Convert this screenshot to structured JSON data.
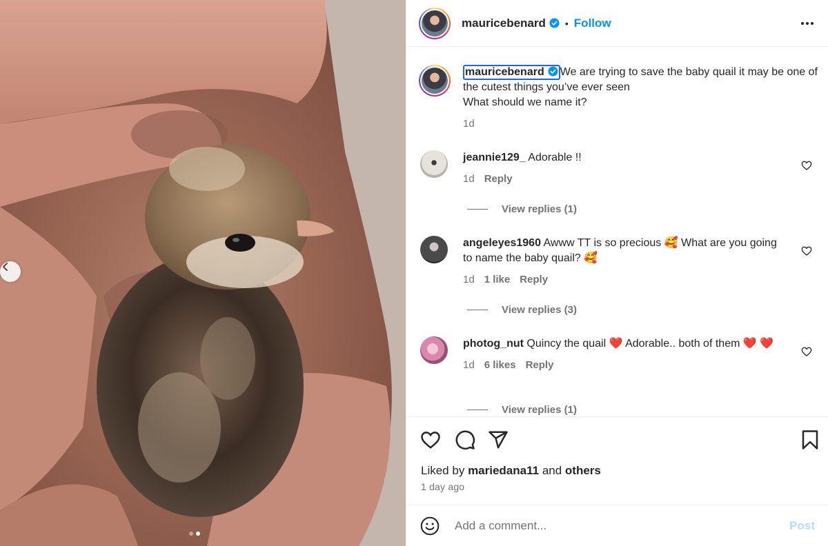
{
  "post": {
    "username": "mauricebenard",
    "separator": "•",
    "follow_label": "Follow",
    "caption_line1": "We are trying to save the baby quail it may be one of the cutest things you’ve ever seen",
    "caption_line2": "What should we name it?",
    "caption_time": "1d"
  },
  "comments": [
    {
      "user": "jeannie129_",
      "text": "Adorable !!",
      "time": "1d",
      "likes": "",
      "reply_label": "Reply",
      "view_replies": "View replies (1)"
    },
    {
      "user": "angeleyes1960",
      "text": "Awww TT is so precious 🥰 What are you going to name the baby quail? 🥰",
      "time": "1d",
      "likes": "1 like",
      "reply_label": "Reply",
      "view_replies": "View replies (3)"
    },
    {
      "user": "photog_nut",
      "text": "Quincy the quail ❤️ Adorable.. both of them ❤️ ❤️",
      "time": "1d",
      "likes": "6 likes",
      "reply_label": "Reply",
      "view_replies": "View replies (1)"
    }
  ],
  "likes": {
    "prefix": "Liked by",
    "user": "mariedana11",
    "and": "and",
    "others": "others"
  },
  "timestamp": "1 day ago",
  "composer": {
    "placeholder": "Add a comment...",
    "post_label": "Post"
  },
  "carousel": {
    "slide_count": 2,
    "active_slide": 2
  },
  "colors": {
    "accent": "#0095f6",
    "post_disabled": "#b2dffc",
    "muted": "#737373",
    "text": "#262626"
  },
  "icons": [
    "verified-badge-icon",
    "more-options-icon",
    "heart-icon",
    "comment-icon",
    "share-icon",
    "bookmark-icon",
    "emoji-icon",
    "chevron-left-icon"
  ]
}
